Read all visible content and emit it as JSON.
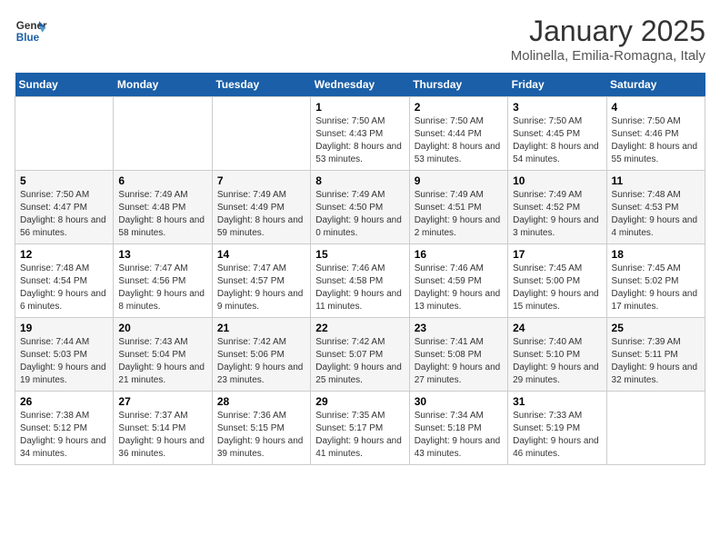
{
  "logo": {
    "line1": "General",
    "line2": "Blue"
  },
  "title": "January 2025",
  "location": "Molinella, Emilia-Romagna, Italy",
  "weekdays": [
    "Sunday",
    "Monday",
    "Tuesday",
    "Wednesday",
    "Thursday",
    "Friday",
    "Saturday"
  ],
  "weeks": [
    [
      {
        "day": "",
        "info": ""
      },
      {
        "day": "",
        "info": ""
      },
      {
        "day": "",
        "info": ""
      },
      {
        "day": "1",
        "info": "Sunrise: 7:50 AM\nSunset: 4:43 PM\nDaylight: 8 hours and 53 minutes."
      },
      {
        "day": "2",
        "info": "Sunrise: 7:50 AM\nSunset: 4:44 PM\nDaylight: 8 hours and 53 minutes."
      },
      {
        "day": "3",
        "info": "Sunrise: 7:50 AM\nSunset: 4:45 PM\nDaylight: 8 hours and 54 minutes."
      },
      {
        "day": "4",
        "info": "Sunrise: 7:50 AM\nSunset: 4:46 PM\nDaylight: 8 hours and 55 minutes."
      }
    ],
    [
      {
        "day": "5",
        "info": "Sunrise: 7:50 AM\nSunset: 4:47 PM\nDaylight: 8 hours and 56 minutes."
      },
      {
        "day": "6",
        "info": "Sunrise: 7:49 AM\nSunset: 4:48 PM\nDaylight: 8 hours and 58 minutes."
      },
      {
        "day": "7",
        "info": "Sunrise: 7:49 AM\nSunset: 4:49 PM\nDaylight: 8 hours and 59 minutes."
      },
      {
        "day": "8",
        "info": "Sunrise: 7:49 AM\nSunset: 4:50 PM\nDaylight: 9 hours and 0 minutes."
      },
      {
        "day": "9",
        "info": "Sunrise: 7:49 AM\nSunset: 4:51 PM\nDaylight: 9 hours and 2 minutes."
      },
      {
        "day": "10",
        "info": "Sunrise: 7:49 AM\nSunset: 4:52 PM\nDaylight: 9 hours and 3 minutes."
      },
      {
        "day": "11",
        "info": "Sunrise: 7:48 AM\nSunset: 4:53 PM\nDaylight: 9 hours and 4 minutes."
      }
    ],
    [
      {
        "day": "12",
        "info": "Sunrise: 7:48 AM\nSunset: 4:54 PM\nDaylight: 9 hours and 6 minutes."
      },
      {
        "day": "13",
        "info": "Sunrise: 7:47 AM\nSunset: 4:56 PM\nDaylight: 9 hours and 8 minutes."
      },
      {
        "day": "14",
        "info": "Sunrise: 7:47 AM\nSunset: 4:57 PM\nDaylight: 9 hours and 9 minutes."
      },
      {
        "day": "15",
        "info": "Sunrise: 7:46 AM\nSunset: 4:58 PM\nDaylight: 9 hours and 11 minutes."
      },
      {
        "day": "16",
        "info": "Sunrise: 7:46 AM\nSunset: 4:59 PM\nDaylight: 9 hours and 13 minutes."
      },
      {
        "day": "17",
        "info": "Sunrise: 7:45 AM\nSunset: 5:00 PM\nDaylight: 9 hours and 15 minutes."
      },
      {
        "day": "18",
        "info": "Sunrise: 7:45 AM\nSunset: 5:02 PM\nDaylight: 9 hours and 17 minutes."
      }
    ],
    [
      {
        "day": "19",
        "info": "Sunrise: 7:44 AM\nSunset: 5:03 PM\nDaylight: 9 hours and 19 minutes."
      },
      {
        "day": "20",
        "info": "Sunrise: 7:43 AM\nSunset: 5:04 PM\nDaylight: 9 hours and 21 minutes."
      },
      {
        "day": "21",
        "info": "Sunrise: 7:42 AM\nSunset: 5:06 PM\nDaylight: 9 hours and 23 minutes."
      },
      {
        "day": "22",
        "info": "Sunrise: 7:42 AM\nSunset: 5:07 PM\nDaylight: 9 hours and 25 minutes."
      },
      {
        "day": "23",
        "info": "Sunrise: 7:41 AM\nSunset: 5:08 PM\nDaylight: 9 hours and 27 minutes."
      },
      {
        "day": "24",
        "info": "Sunrise: 7:40 AM\nSunset: 5:10 PM\nDaylight: 9 hours and 29 minutes."
      },
      {
        "day": "25",
        "info": "Sunrise: 7:39 AM\nSunset: 5:11 PM\nDaylight: 9 hours and 32 minutes."
      }
    ],
    [
      {
        "day": "26",
        "info": "Sunrise: 7:38 AM\nSunset: 5:12 PM\nDaylight: 9 hours and 34 minutes."
      },
      {
        "day": "27",
        "info": "Sunrise: 7:37 AM\nSunset: 5:14 PM\nDaylight: 9 hours and 36 minutes."
      },
      {
        "day": "28",
        "info": "Sunrise: 7:36 AM\nSunset: 5:15 PM\nDaylight: 9 hours and 39 minutes."
      },
      {
        "day": "29",
        "info": "Sunrise: 7:35 AM\nSunset: 5:17 PM\nDaylight: 9 hours and 41 minutes."
      },
      {
        "day": "30",
        "info": "Sunrise: 7:34 AM\nSunset: 5:18 PM\nDaylight: 9 hours and 43 minutes."
      },
      {
        "day": "31",
        "info": "Sunrise: 7:33 AM\nSunset: 5:19 PM\nDaylight: 9 hours and 46 minutes."
      },
      {
        "day": "",
        "info": ""
      }
    ]
  ]
}
